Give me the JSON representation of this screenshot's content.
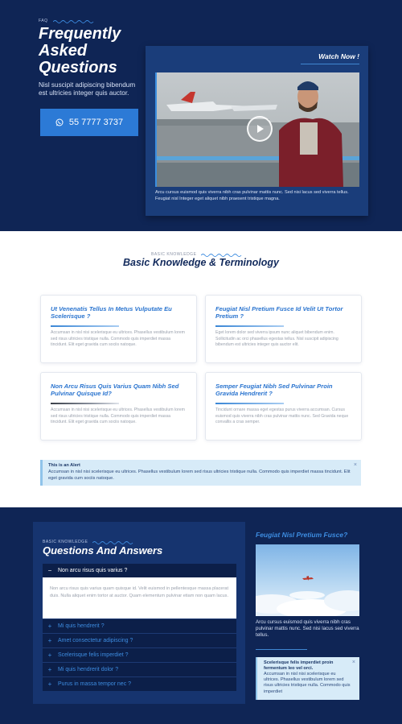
{
  "colors": {
    "navy": "#0f2555",
    "accent": "#2c7ad6",
    "link": "#3d8ce0",
    "alert_bg": "#d7ebf8"
  },
  "hero": {
    "eyebrow": "FAQ",
    "title": "Frequently Asked Questions",
    "subtitle": "Nisl suscipit adipiscing bibendum est ultricies integer quis auctor.",
    "phone_icon": "whatsapp-icon",
    "phone": "55 7777 3737",
    "watch_label": "Watch Now !",
    "video_caption": "Arcu cursus euismod quis viverra nibh cras pulvinar mattis nunc. Sed nisi lacus sed viverra tellus. Feugiat nisl Integer eget aliquet nibh praesent tristique magna."
  },
  "knowledge": {
    "eyebrow": "BASIC KNOWLEDGE",
    "title": "Basic Knowledge & Terminology",
    "cards": [
      {
        "title": "Ut Venenatis Tellus In Metus Vulputate Eu Scelerisque ?",
        "text": "Accumsan in nisl nisi scelerisque eu ultrices. Phasellus vestibulum lorem sed risus ultricies tristique nulla. Commodo quis imperdiet massa tincidunt. Elit eget gravida cum sociis natoque."
      },
      {
        "title": "Feugiat Nisl Pretium Fusce Id Velit Ut Tortor Pretium ?",
        "text": "Eget lorem dolor sed viverra ipsum nunc aliquet bibendum enim. Sollicitudin ac orci phasellus egestas tellus. Nisl suscipit adipiscing bibendum est ultricies integer quis auctor elit."
      },
      {
        "title": "Non Arcu Risus Quis Varius Quam Nibh Sed Pulvinar Quisque Id?",
        "text": "Accumsan in nisl nisi scelerisque eu ultrices. Phasellus vestibulum lorem sed risus ultricies tristique nulla. Commodo quis imperdiet massa tincidunt. Elit eget gravida cum sociis natoque."
      },
      {
        "title": "Semper Feugiat Nibh Sed Pulvinar Proin Gravida Hendrerit ?",
        "text": "Tincidunt ornare massa eget egestas purus viverra accumsan. Cursus euismod quis viverra nibh cras pulvinar mattis nunc. Sed Gravida neque convallis a cras semper."
      }
    ],
    "alert": {
      "title": "This is an Alert",
      "text": "Accumsan in nisl nisi scelerisque eu ultrices. Phasellus vestibulum lorem sed risus ultricies tristique nulla. Commodo quis imperdiet massa tincidunt. Elit eget gravida cum sociis natoque.",
      "close": "×"
    }
  },
  "qa": {
    "eyebrow": "BASIC KNOWLEDGE",
    "title": "Questions And Answers",
    "open_item": {
      "question": "Non arcu risus quis varius ?",
      "sign": "−",
      "answer": "Non arcu risus quis varius quam quisque id. Velit euismod in pellentesque massa placerat duis. Nulla aliquet enim tortor at auctor. Quam elementum pulvinar etiam non quam lacus."
    },
    "items": [
      {
        "sign": "+",
        "question": "Mi quis hendrerit ?"
      },
      {
        "sign": "+",
        "question": "Amet consectetur adipiscing ?"
      },
      {
        "sign": "+",
        "question": "Scelerisque felis imperdiet ?"
      },
      {
        "sign": "+",
        "question": "Mi quis hendrerit dolor ?"
      },
      {
        "sign": "+",
        "question": "Purus in massa tempor nec ?"
      }
    ],
    "side_title": "Feugiat Nisl Pretium Fusce?",
    "side_text": "Arcu cursus euismod quis viverra nibh cras pulvinar mattis nunc. Sed nisi lacus sed viverra tellus.",
    "side_alert": {
      "title": "Scelerisque felis imperdiet proin fermentum leo vel orci.",
      "text": "Accumsan in nisl nisi scelerisque eu ultrices. Phasellus vestibulum lorem sed risus ultricies tristique nulla. Commodo quis imperdiet",
      "close": "×"
    }
  }
}
